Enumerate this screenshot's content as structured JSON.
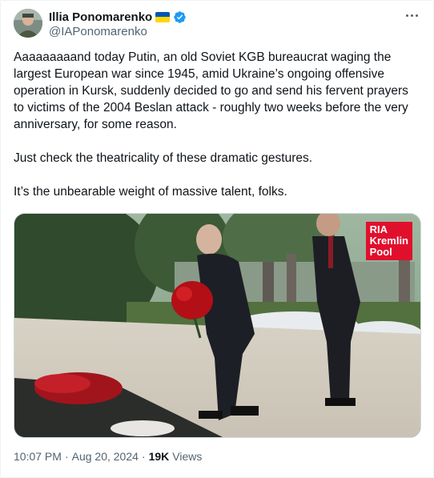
{
  "author": {
    "name": "Illia Ponomarenko",
    "flag": "ukraine-flag",
    "verified_icon": "verified-badge-icon",
    "handle": "@IAPonomarenko"
  },
  "colors": {
    "verified": "#1d9bf0",
    "text": "#0f1419",
    "muted": "#536471",
    "watermark_bg": "#e0102d"
  },
  "tweet": {
    "paragraphs": [
      "Aaaaaaaaand today Putin, an old Soviet KGB bureaucrat waging the largest European war since 1945, amid Ukraine’s ongoing offensive operation in Kursk, suddenly decided to go and send his fervent prayers to victims of the 2004 Beslan attack - roughly two weeks before the very anniversary, for some reason.",
      "Just check the theatricality of these dramatic gestures.",
      "It’s the unbearable weight of massive talent, folks."
    ]
  },
  "media": {
    "watermark": [
      "RIA",
      "Kremlin",
      "Pool"
    ]
  },
  "meta": {
    "time": "10:07 PM",
    "separator": "·",
    "date": "Aug 20, 2024",
    "views_count": "19K",
    "views_label": "Views"
  }
}
